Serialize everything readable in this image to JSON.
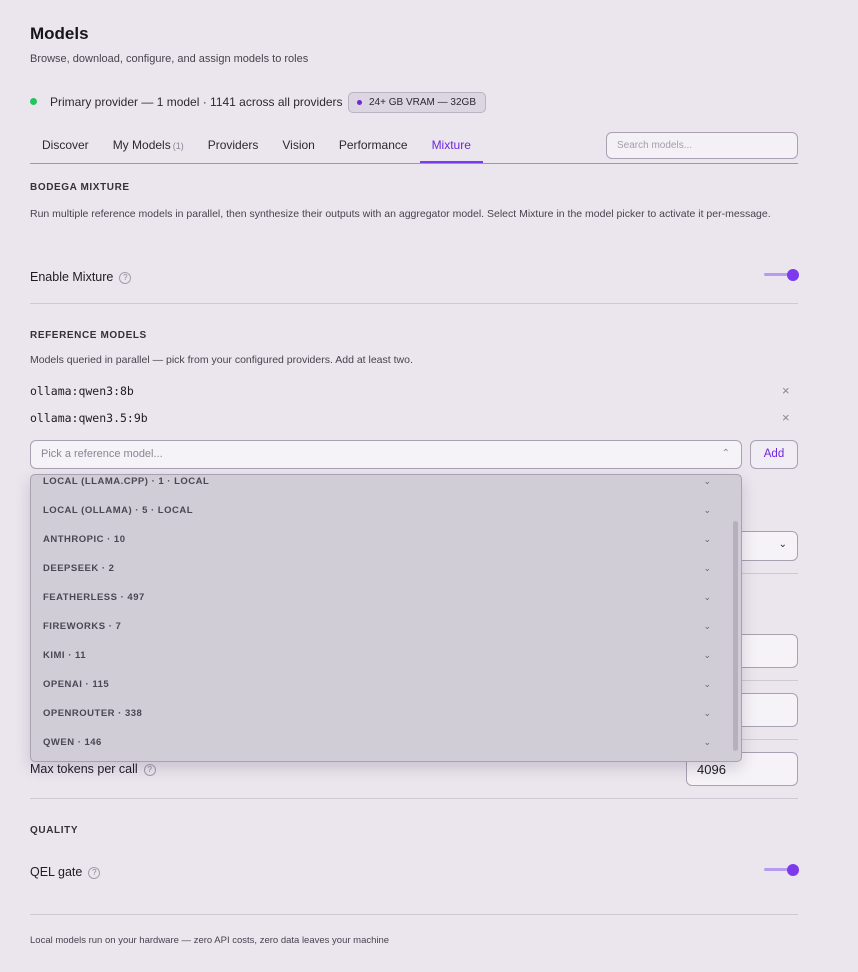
{
  "header": {
    "title": "Models",
    "subtitle": "Browse, download, configure, and assign models to roles"
  },
  "status": {
    "text": "Primary provider — 1 model · 1141 across all providers",
    "badge": "24+ GB VRAM — 32GB",
    "dot_color": "#22c55e"
  },
  "tabs": [
    {
      "label": "Discover",
      "count": ""
    },
    {
      "label": "My Models",
      "count": "(1)"
    },
    {
      "label": "Providers",
      "count": ""
    },
    {
      "label": "Vision",
      "count": ""
    },
    {
      "label": "Performance",
      "count": ""
    },
    {
      "label": "Mixture",
      "count": "",
      "active": true
    }
  ],
  "search": {
    "placeholder": "Search models..."
  },
  "mixture": {
    "heading": "BODEGA MIXTURE",
    "description": "Run multiple reference models in parallel, then synthesize their outputs with an aggregator model. Select Mixture in the model picker to activate it per-message.",
    "enable_label": "Enable Mixture",
    "enabled": true
  },
  "reference": {
    "heading": "REFERENCE MODELS",
    "description": "Models queried in parallel — pick from your configured providers. Add at least two.",
    "models": [
      "ollama:qwen3:8b",
      "ollama:qwen3.5:9b"
    ],
    "remove_symbol": "×",
    "picker_placeholder": "Pick a reference model...",
    "add_label": "Add"
  },
  "dropdown": {
    "groups": [
      "LOCAL (LLAMA.CPP) · 1 · LOCAL",
      "LOCAL (OLLAMA) · 5 · LOCAL",
      "ANTHROPIC · 10",
      "DEEPSEEK · 2",
      "FEATHERLESS · 497",
      "FIREWORKS · 7",
      "KIMI · 11",
      "OPENAI · 115",
      "OPENROUTER · 338",
      "QWEN · 146"
    ],
    "chevron": "⌄"
  },
  "limits": {
    "max_tokens_label": "Max tokens per call",
    "max_tokens_value": "4096"
  },
  "quality": {
    "heading": "QUALITY",
    "qel_label": "QEL gate",
    "qel_enabled": true
  },
  "footer": {
    "text": "Local models run on your hardware — zero API costs, zero data leaves your machine"
  },
  "colors": {
    "accent": "#7c3aed",
    "background": "#ebe6ee"
  },
  "icons": {
    "help": "?",
    "chevron_down": "⌄"
  }
}
